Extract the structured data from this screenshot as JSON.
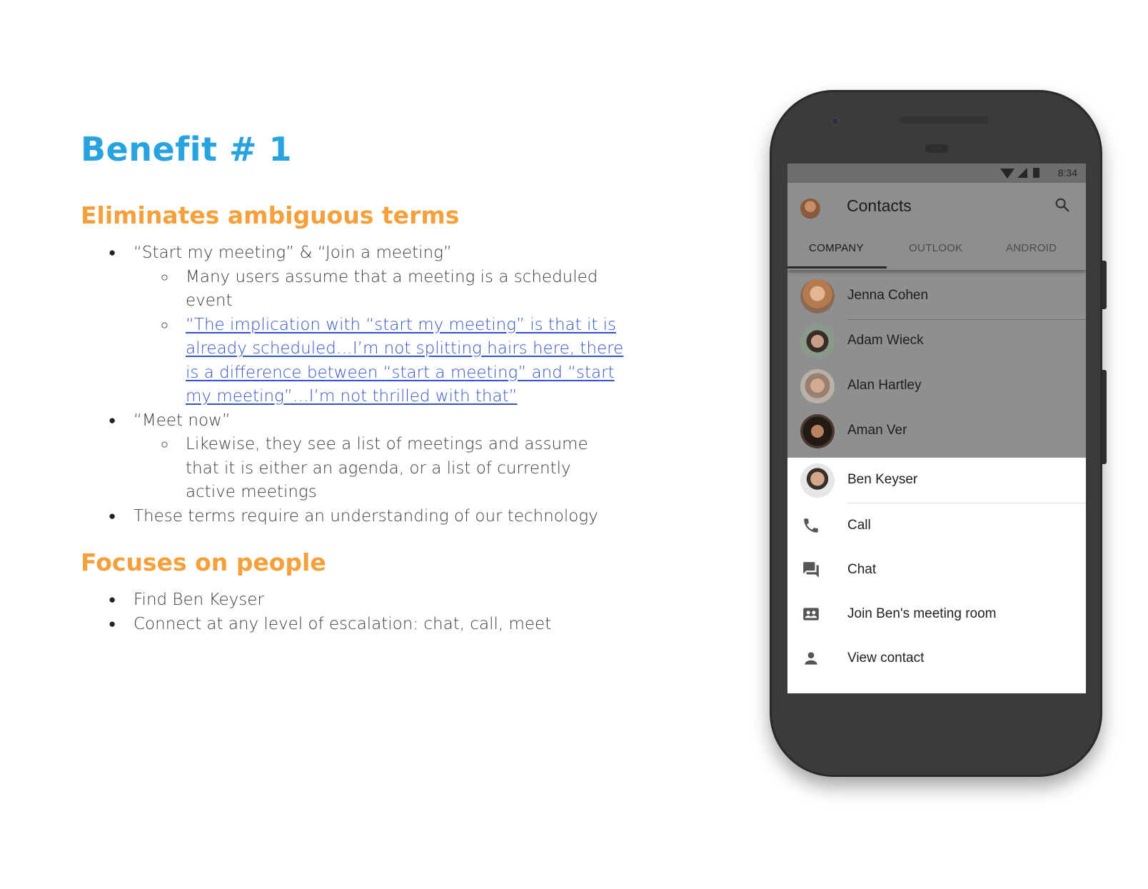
{
  "slide": {
    "title": "Benefit # 1",
    "section1": {
      "heading": "Eliminates ambiguous terms",
      "bullet1": "“Start my meeting” & “Join a meeting”",
      "sub1a": "Many users assume that a meeting is a scheduled event",
      "sub1b_link": "“The implication with “start my meeting” is that it is already scheduled…I’m not splitting hairs here, there is a difference between “start a meeting” and “start my meeting”…I’m not thrilled with that”",
      "bullet2": "“Meet now”",
      "sub2a": "Likewise, they see a list of meetings and assume that it is either an agenda, or a list of currently active meetings",
      "bullet3": "These terms require an understanding of our technology"
    },
    "section2": {
      "heading": "Focuses on people",
      "bullet1": "Find Ben Keyser",
      "bullet2": "Connect at any level of escalation: chat, call, meet"
    },
    "bullet_glyph": "●",
    "circle_glyph": "○"
  },
  "phone": {
    "status_time": "8:34",
    "app_title": "Contacts",
    "tabs": [
      "COMPANY",
      "OUTLOOK",
      "ANDROID"
    ],
    "active_tab": "COMPANY",
    "contacts": [
      "Jenna Cohen",
      "Adam Wieck",
      "Alan Hartley",
      "Aman Ver"
    ],
    "selected_contact": "Ben Keyser",
    "actions": [
      {
        "label": "Call",
        "icon": "phone-icon"
      },
      {
        "label": "Chat",
        "icon": "chat-icon"
      },
      {
        "label": "Join Ben's meeting room",
        "icon": "meeting-room-icon"
      },
      {
        "label": "View contact",
        "icon": "person-icon"
      }
    ],
    "colors": {
      "title_blue": "#29a3df",
      "heading_orange": "#f5a03a",
      "link_blue": "#3354c7"
    }
  }
}
